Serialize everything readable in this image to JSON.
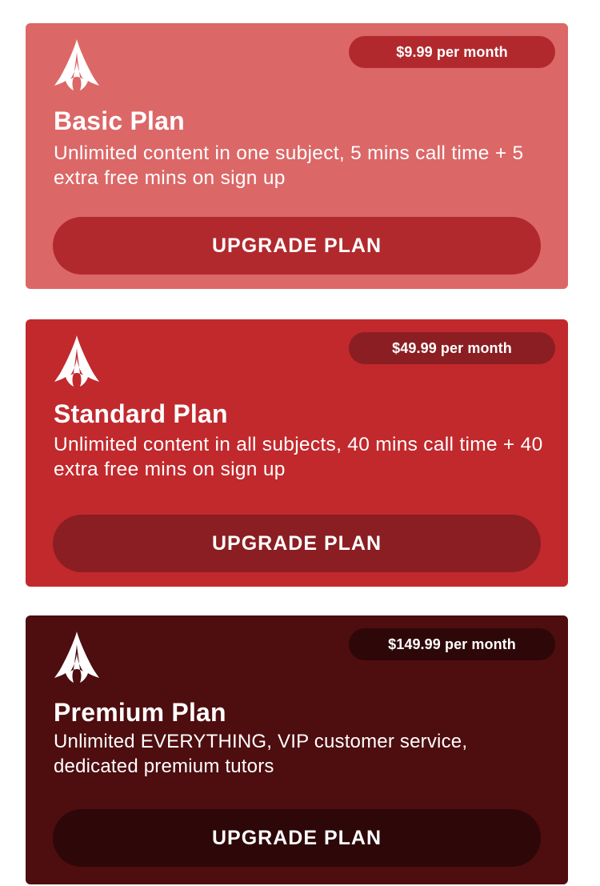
{
  "colors": {
    "basic_card": "#dc6767",
    "basic_pill": "#b2292d",
    "basic_button": "#b2292d",
    "standard_card": "#c1292d",
    "standard_pill": "#8b1e22",
    "standard_button": "#8b1e22",
    "premium_card": "#4e0d0f",
    "premium_pill": "#2e0709",
    "premium_button": "#2e0709"
  },
  "plans": [
    {
      "logo_icon": "assassin-emblem-icon",
      "price": "$9.99 per month",
      "title": "Basic Plan",
      "description": "Unlimited content in one subject, 5 mins call time + 5 extra free mins on sign up",
      "button_label": "UPGRADE PLAN"
    },
    {
      "logo_icon": "assassin-emblem-icon",
      "price": "$49.99 per month",
      "title": "Standard Plan",
      "description": "Unlimited content in all subjects, 40 mins call time + 40 extra free mins on sign up",
      "button_label": "UPGRADE PLAN"
    },
    {
      "logo_icon": "assassin-emblem-icon",
      "price": "$149.99 per month",
      "title": "Premium Plan",
      "description": "Unlimited EVERYTHING, VIP customer service, dedicated premium tutors",
      "button_label": "UPGRADE PLAN"
    }
  ]
}
